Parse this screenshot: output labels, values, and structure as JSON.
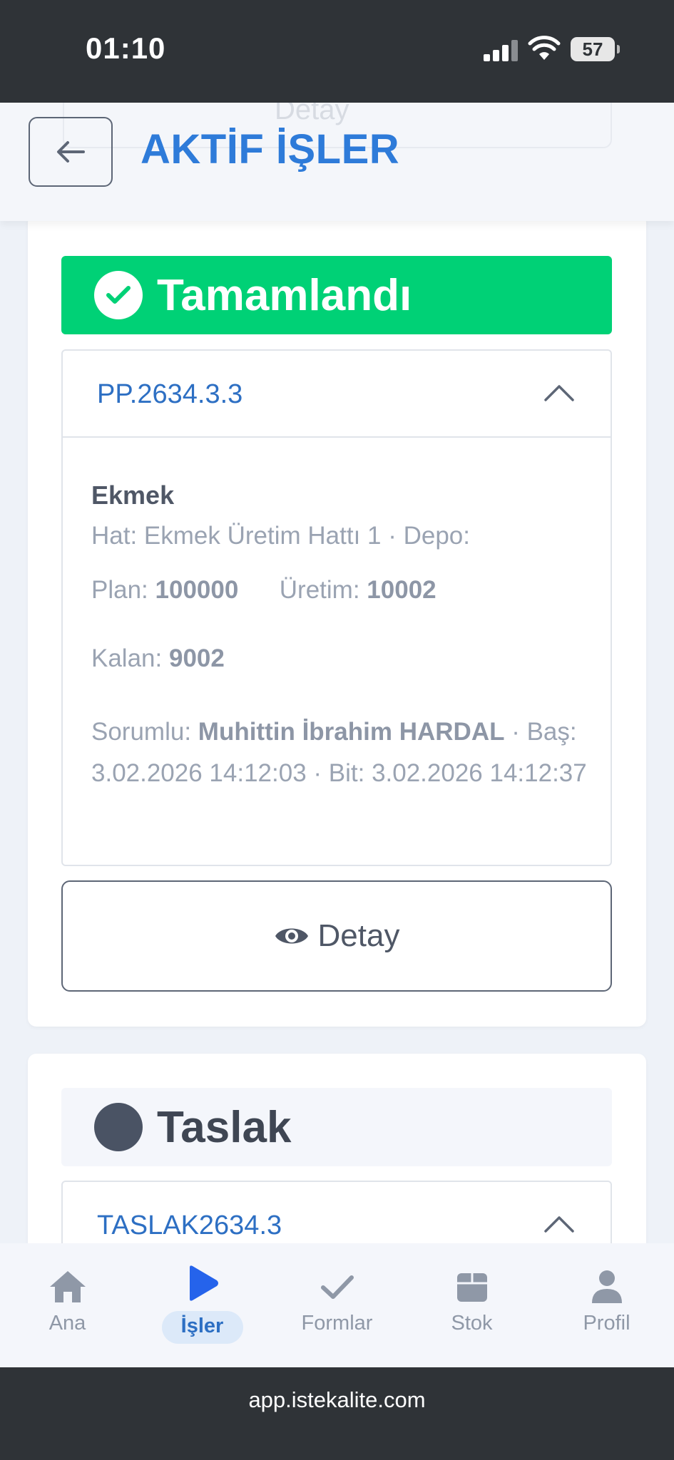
{
  "status_bar": {
    "time": "01:10",
    "battery": "57"
  },
  "header": {
    "title": "AKTİF İŞLER",
    "ghost_button": "Detay"
  },
  "jobs": [
    {
      "status": "Tamamlandı",
      "code": "PP.2634.3.3",
      "product": "Ekmek",
      "line_info": "Hat: Ekmek Üretim Hattı 1 · Depo:",
      "plan_label": "Plan:",
      "plan_value": "100000",
      "production_label": "Üretim:",
      "production_value": "10002",
      "remaining_label": "Kalan:",
      "remaining_value": "9002",
      "responsible_label": "Sorumlu:",
      "responsible_value": "Muhittin İbrahim HARDAL",
      "dates": " · Baş: 3.02.2026 14:12:03 · Bit: 3.02.2026 14:12:37",
      "detail_button": "Detay"
    },
    {
      "status": "Taslak",
      "code": "TASLAK2634.3"
    }
  ],
  "bottom_nav": [
    {
      "label": "Ana",
      "icon": "home-icon"
    },
    {
      "label": "İşler",
      "icon": "play-icon",
      "active": true
    },
    {
      "label": "Formlar",
      "icon": "check-icon"
    },
    {
      "label": "Stok",
      "icon": "box-icon"
    },
    {
      "label": "Profil",
      "icon": "user-icon"
    }
  ],
  "url_bar": {
    "url": "app.istekalite.com"
  },
  "colors": {
    "accent": "#2e7bd9",
    "done": "#00d176",
    "draft": "#4a5364"
  }
}
